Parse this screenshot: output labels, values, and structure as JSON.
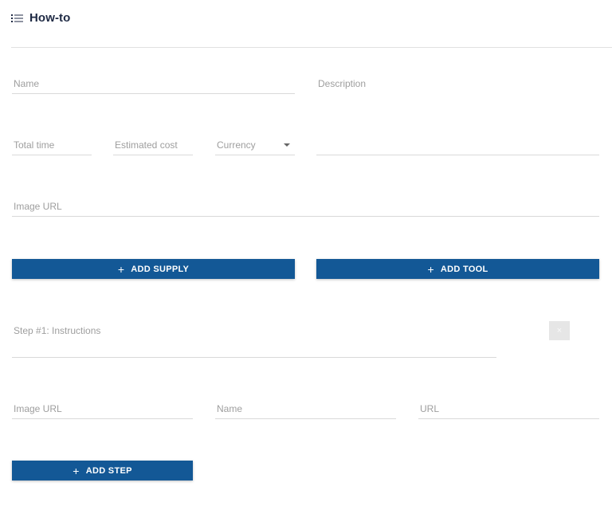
{
  "header": {
    "title": "How-to",
    "icon": "list-icon"
  },
  "form": {
    "name_placeholder": "Name",
    "description_placeholder": "Description",
    "total_time_placeholder": "Total time",
    "estimated_cost_placeholder": "Estimated cost",
    "currency_placeholder": "Currency",
    "image_url_placeholder": "Image URL"
  },
  "actions": {
    "add_supply_label": "ADD SUPPLY",
    "add_tool_label": "ADD TOOL",
    "add_step_label": "ADD STEP",
    "plus_glyph": "+"
  },
  "step": {
    "instructions_placeholder": "Step #1: Instructions",
    "image_url_placeholder": "Image URL",
    "name_placeholder": "Name",
    "url_placeholder": "URL",
    "remove_glyph": "×"
  },
  "colors": {
    "primary": "#135896",
    "text_dark": "#1f2a44",
    "placeholder": "#9e9e9e"
  }
}
